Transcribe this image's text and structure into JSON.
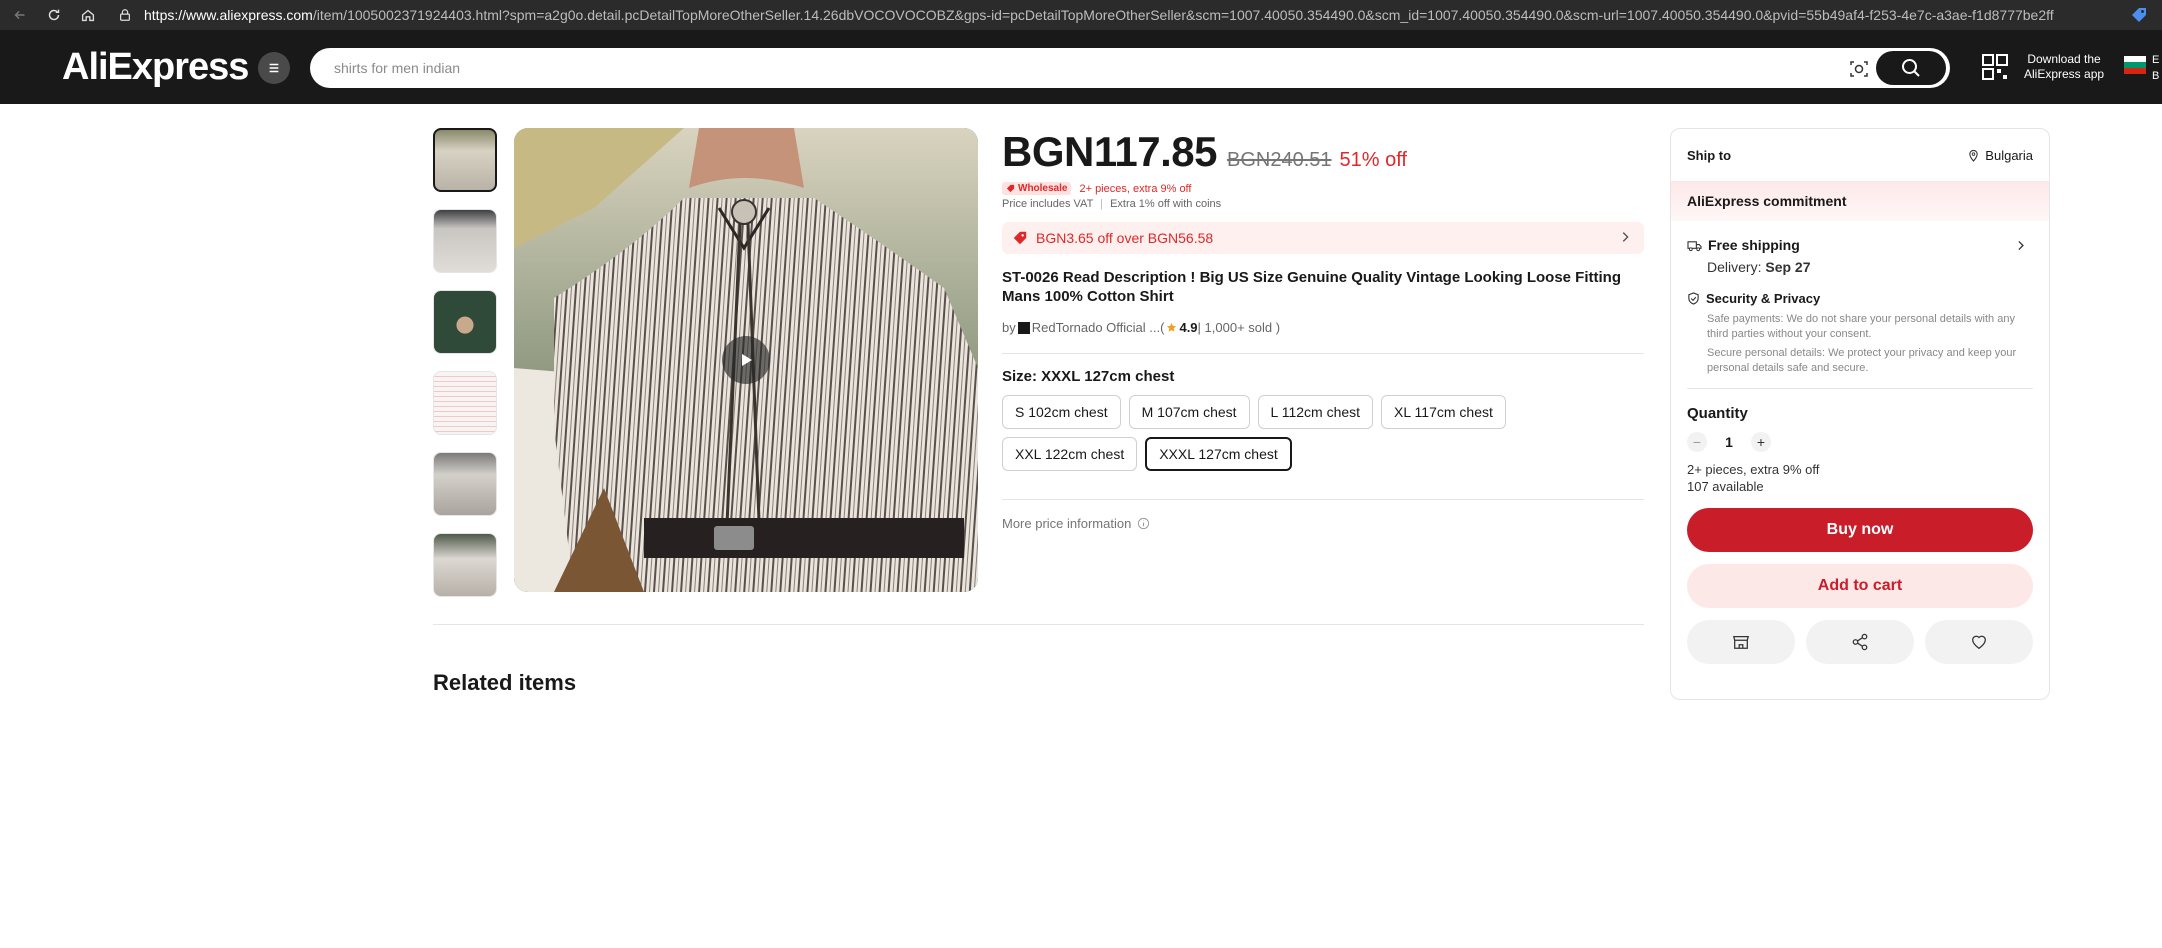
{
  "browser": {
    "url_domain": "https://www.aliexpress.com",
    "url_rest": "/item/1005002371924403.html?spm=a2g0o.detail.pcDetailTopMoreOtherSeller.14.26dbVOCOVOCOBZ&gps-id=pcDetailTopMoreOtherSeller&scm=1007.40050.354490.0&scm_id=1007.40050.354490.0&scm-url=1007.40050.354490.0&pvid=55b49af4-f253-4e7c-a3ae-f1d8777be2ff&_..."
  },
  "header": {
    "logo": "AliExpress",
    "search_placeholder": "shirts for men indian",
    "app_line1": "Download the",
    "app_line2": "AliExpress app",
    "lang_line1": "E",
    "lang_line2": "B"
  },
  "product": {
    "price": "BGN117.85",
    "original_price": "BGN240.51",
    "discount": "51% off",
    "wholesale_badge": "Wholesale",
    "wholesale_text": "2+ pieces, extra 9% off",
    "vat_text": "Price includes VAT",
    "coins_text": "Extra 1% off with coins",
    "coupon_text": "BGN3.65 off over BGN56.58",
    "title": "ST-0026 Read Description ! Big US Size Genuine Quality Vintage Looking Loose Fitting Mans 100% Cotton Shirt",
    "by": "by",
    "store": "RedTornado Official ...",
    "open_paren": " (",
    "rating": "4.9",
    "sold": " | 1,000+ sold )",
    "size_label": "Size: XXXL 127cm chest",
    "sizes": [
      "S 102cm chest",
      "M 107cm chest",
      "L 112cm chest",
      "XL 117cm chest",
      "XXL 122cm chest",
      "XXXL 127cm chest"
    ],
    "selected_size": "XXXL 127cm chest",
    "more_price": "More price information"
  },
  "related": {
    "title": "Related items"
  },
  "panel": {
    "ship_to_label": "Ship to",
    "ship_to_country": "Bulgaria",
    "commitment": "AliExpress commitment",
    "free_shipping": "Free shipping",
    "delivery_label": "Delivery: ",
    "delivery_date": "Sep 27",
    "security_title": "Security & Privacy",
    "security_p1": "Safe payments: We do not share your personal details with any third parties without your consent.",
    "security_p2": "Secure personal details: We protect your privacy and keep your personal details safe and secure.",
    "quantity_label": "Quantity",
    "quantity_value": "1",
    "qty_note": "2+ pieces, extra 9% off",
    "available": "107 available",
    "buy_now": "Buy now",
    "add_to_cart": "Add to cart"
  },
  "colors": {
    "brand_red": "#c91d29",
    "discount_red": "#e02828",
    "header_dark": "#191919"
  },
  "icons": [
    "back-icon",
    "reload-icon",
    "home-icon",
    "lock-icon",
    "tag-icon",
    "menu-icon",
    "camera-icon",
    "search-icon",
    "qr-icon",
    "flag-icon",
    "play-icon",
    "coupon-icon",
    "chevron-right-icon",
    "star-icon",
    "info-icon",
    "location-icon",
    "truck-icon",
    "shield-icon",
    "store-icon",
    "share-icon",
    "heart-icon"
  ]
}
